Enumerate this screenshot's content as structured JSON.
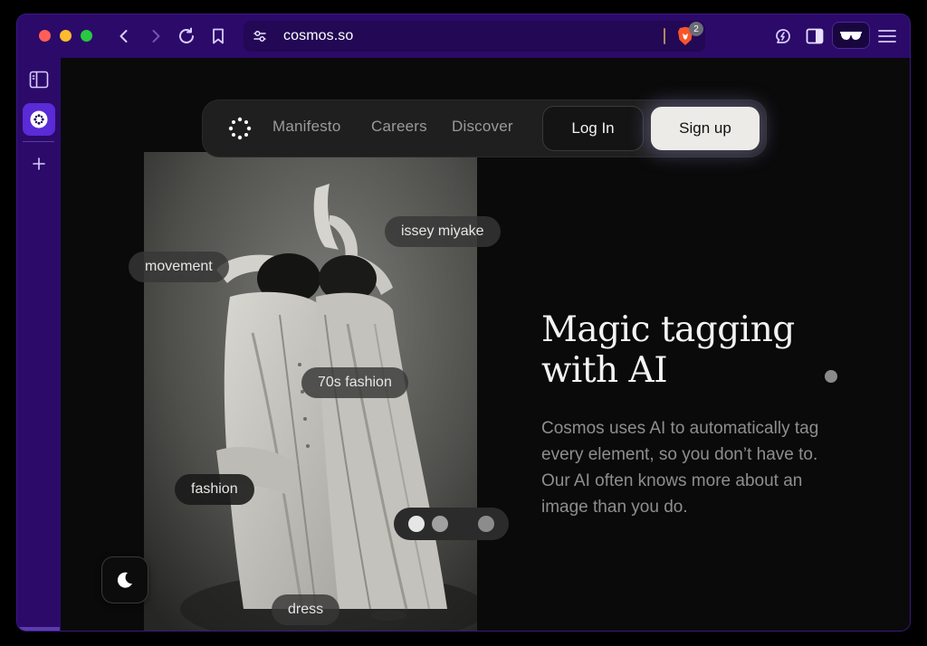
{
  "browser": {
    "url": "cosmos.so",
    "shield_count": "2",
    "icons": {
      "back": "chevron-left-icon",
      "forward": "chevron-right-icon",
      "reload": "reload-icon",
      "bookmark": "bookmark-icon",
      "site_settings": "site-settings-icon",
      "shields": "brave-lion-icon",
      "leo": "leo-ai-icon",
      "sidebar_toggle": "sidebar-panel-icon",
      "private": "glasses-icon",
      "menu": "hamburger-menu-icon"
    },
    "sidebar_icons": [
      "sidebar-panel-icon",
      "cosmos-favicon-icon",
      "plus-icon"
    ],
    "accent": "#2b0a69"
  },
  "nav": {
    "links": [
      "Manifesto",
      "Careers",
      "Discover"
    ],
    "login_label": "Log In",
    "signup_label": "Sign up"
  },
  "tags": {
    "issey": "issey miyake",
    "movement": "movement",
    "seventies": "70s fashion",
    "fashion": "fashion",
    "dress": "dress"
  },
  "hero": {
    "headline_line1": "Magic tagging",
    "headline_line2": "with AI",
    "description": "Cosmos uses AI to automatically tag every element, so you don’t have to. Our AI often knows more about an image than you do."
  },
  "carousel": {
    "count": 4,
    "active_index": 0
  },
  "theme_toggle_icon": "moon-icon"
}
